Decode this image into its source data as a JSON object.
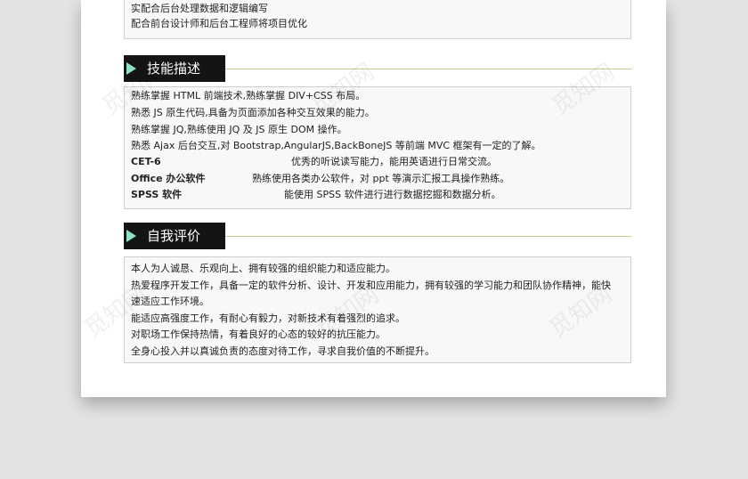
{
  "top_box": {
    "lines": [
      "实配合后台处理数据和逻辑编写",
      "配合前台设计师和后台工程师将项目优化"
    ]
  },
  "skills": {
    "title": "技能描述",
    "lines": [
      "熟练掌握 HTML 前端技术,熟练掌握 DIV+CSS 布局。",
      "熟悉 JS 原生代码,具备为页面添加各种交互效果的能力。",
      "熟练掌握 JQ,熟练使用 JQ 及 JS 原生 DOM 操作。",
      "熟悉 Ajax 后台交互,对 Bootstrap,AngularJS,BackBoneJS 等前端 MVC 框架有一定的了解。"
    ],
    "rows": [
      {
        "key": "CET-6",
        "value": "优秀的听说读写能力，能用英语进行日常交流。"
      },
      {
        "key": "Office 办公软件",
        "value": "熟练使用各类办公软件，对 ppt 等演示汇报工具操作熟练。"
      },
      {
        "key": "SPSS 软件",
        "value": "能使用 SPSS 软件进行进行数据挖掘和数据分析。"
      }
    ]
  },
  "self_eval": {
    "title": "自我评价",
    "lines": [
      "本人为人诚恳、乐观向上、拥有较强的组织能力和适应能力。",
      "热爱程序开发工作，具备一定的软件分析、设计、开发和应用能力，拥有较强的学习能力和团队协作精神，能快",
      "速适应工作环境。",
      "能适应高强度工作，有耐心有毅力，对新技术有着强烈的追求。",
      "对职场工作保持热情，有着良好的心态的较好的抗压能力。",
      "全身心投入并以真诚负责的态度对待工作，寻求自我价值的不断提升。"
    ]
  },
  "watermark": "觅知网"
}
